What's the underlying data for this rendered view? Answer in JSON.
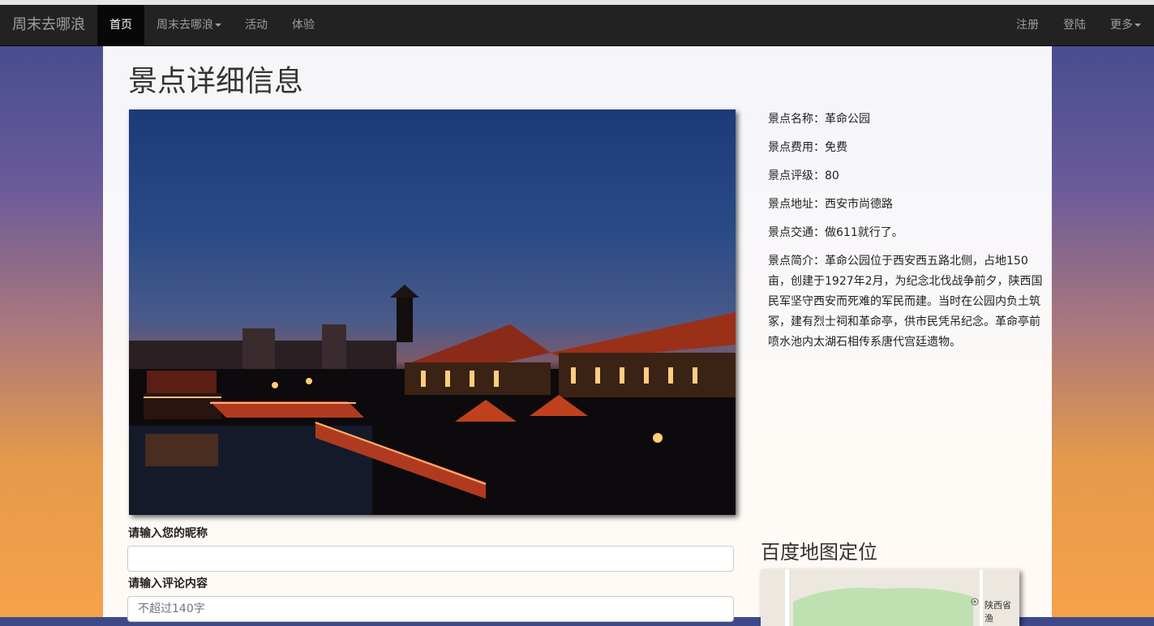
{
  "nav": {
    "brand": "周末去哪浪",
    "items": [
      {
        "label": "首页",
        "active": true
      },
      {
        "label": "周末去哪浪",
        "dropdown": true
      },
      {
        "label": "活动"
      },
      {
        "label": "体验"
      }
    ],
    "right": [
      {
        "label": "注册"
      },
      {
        "label": "登陆"
      },
      {
        "label": "更多",
        "dropdown": true
      }
    ]
  },
  "page": {
    "title": "景点详细信息"
  },
  "spot": {
    "name": "景点名称：革命公园",
    "fee": "景点费用：免费",
    "rating": "景点评级：80",
    "address": "景点地址：西安市尚德路",
    "traffic": "景点交通：做611就行了。",
    "intro": "景点简介：革命公园位于西安西五路北侧，占地150亩，创建于1927年2月，为纪念北伐战争前夕，陕西国民军坚守西安而死难的军民而建。当时在公园内负土筑冢，建有烈士祠和革命亭，供市民凭吊纪念。革命亭前喷水池内太湖石相传系唐代宫廷遗物。"
  },
  "form": {
    "nickname_label": "请输入您的昵称",
    "nickname_value": "",
    "comment_label": "请输入评论内容",
    "comment_placeholder": "不超过140字"
  },
  "map": {
    "title": "百度地图定位",
    "label": "陕西省渔"
  }
}
